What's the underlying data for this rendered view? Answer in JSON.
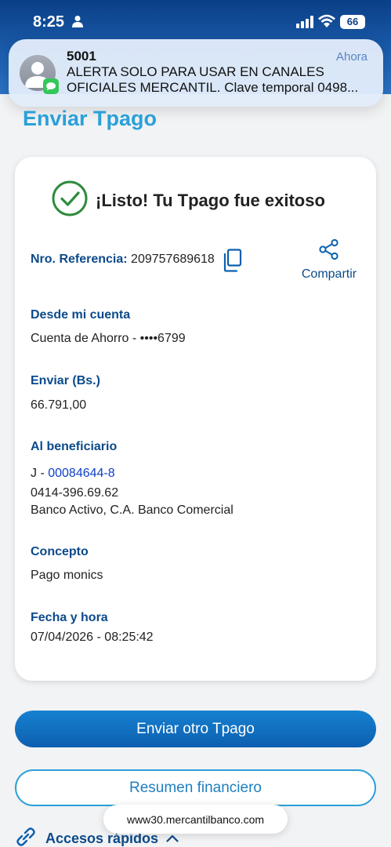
{
  "status_bar": {
    "time": "8:25",
    "battery": "66"
  },
  "notification": {
    "sender": "5001",
    "time": "Ahora",
    "message": "ALERTA SOLO PARA USAR EN CANALES OFICIALES MERCANTIL. Clave temporal 0498..."
  },
  "page": {
    "title": "Enviar Tpago"
  },
  "receipt": {
    "success_message": "¡Listo! Tu Tpago fue exitoso",
    "reference_label": "Nro. Referencia:",
    "reference_number": "209757689618",
    "share_label": "Compartir",
    "from_account_label": "Desde mi cuenta",
    "from_account_value": "Cuenta de Ahorro - ••••6799",
    "amount_label": "Enviar (Bs.)",
    "amount_value": "66.791,00",
    "beneficiary_label": "Al beneficiario",
    "beneficiary_id_prefix": "J - ",
    "beneficiary_id": "00084644-8",
    "beneficiary_phone": "0414-396.69.62",
    "beneficiary_bank": "Banco Activo, C.A. Banco Comercial",
    "concept_label": "Concepto",
    "concept_value": "Pago monics",
    "datetime_label": "Fecha y hora",
    "datetime_value": "07/04/2026 - 08:25:42"
  },
  "actions": {
    "send_another": "Enviar otro Tpago",
    "financial_summary": "Resumen financiero",
    "quick_access": "Accesos rápidos"
  },
  "browser": {
    "url": "www30.mercantilbanco.com"
  },
  "colors": {
    "header_blue": "#0a3f86",
    "title_cyan": "#2aa0d9",
    "label_blue": "#0c4a8a",
    "success_green": "#2e8b3c",
    "link_blue": "#0f3fc8"
  }
}
